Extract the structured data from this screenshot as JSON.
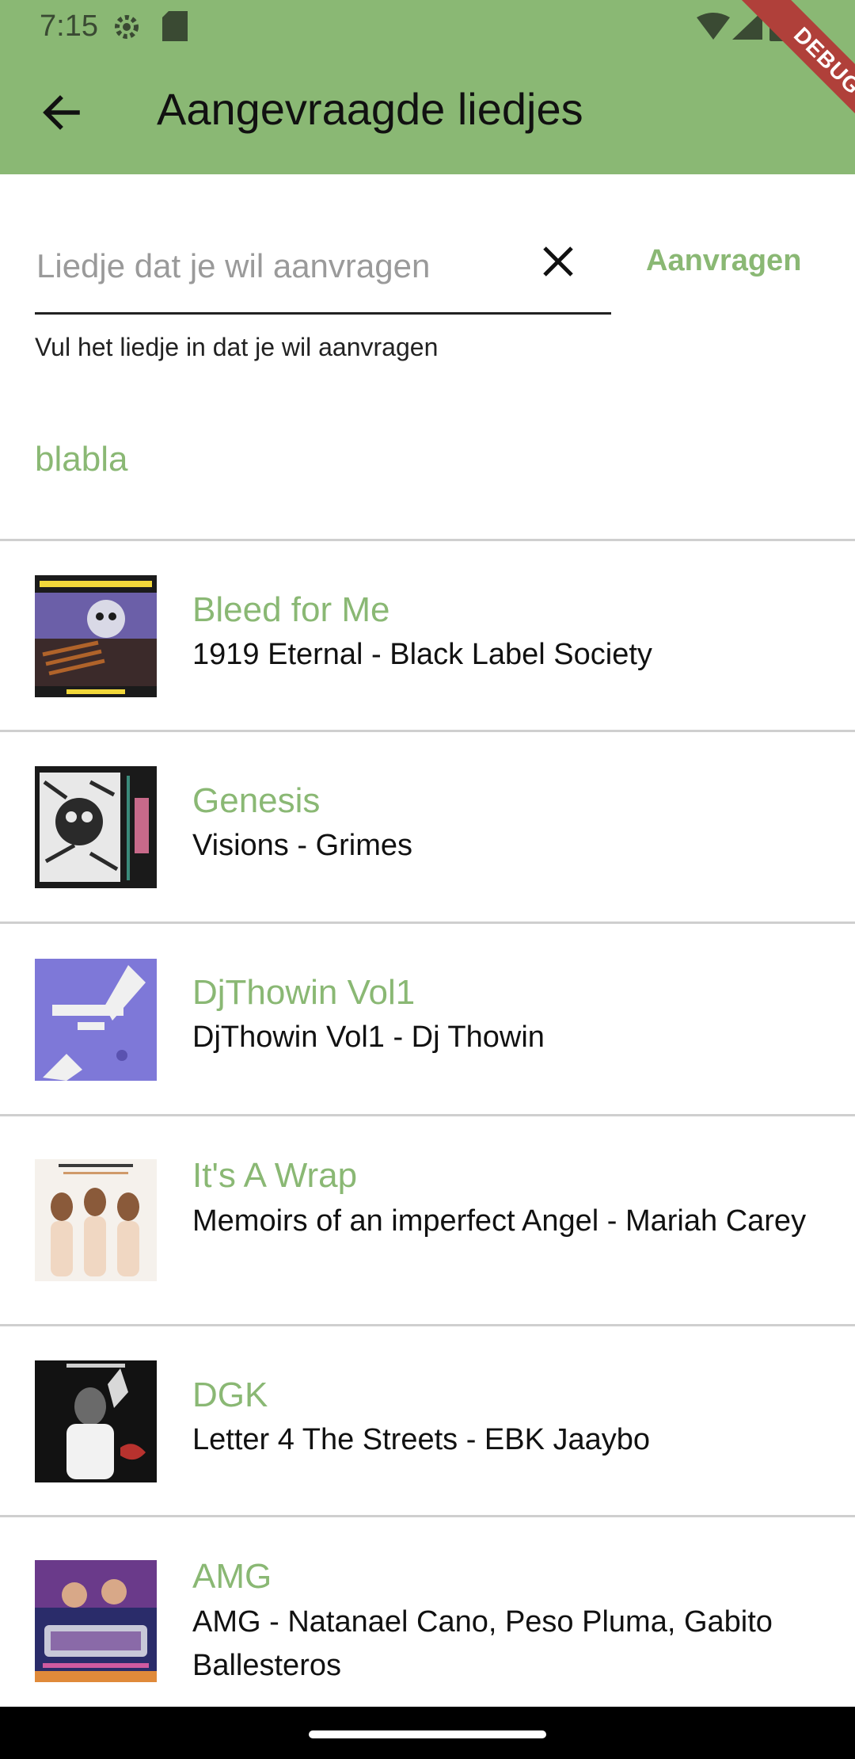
{
  "status_bar": {
    "time": "7:15",
    "icons": [
      "gear-icon",
      "sd-card-icon",
      "wifi-icon",
      "signal-icon",
      "battery-icon"
    ]
  },
  "debug_banner": "DEBUG",
  "app_bar": {
    "title": "Aangevraagde liedjes",
    "back_icon": "arrow-back-icon"
  },
  "request_form": {
    "input_value": "",
    "input_placeholder": "Liedje dat je wil aanvragen",
    "clear_icon": "close-icon",
    "submit_label": "Aanvragen",
    "helper_text": "Vul het liedje in dat je wil aanvragen"
  },
  "entered_request": "blabla",
  "songs": [
    {
      "title": "Bleed for Me",
      "subtitle": "1919 Eternal - Black Label Society"
    },
    {
      "title": "Genesis",
      "subtitle": "Visions - Grimes"
    },
    {
      "title": "DjThowin Vol1",
      "subtitle": "DjThowin Vol1 - Dj Thowin"
    },
    {
      "title": "It's A Wrap",
      "subtitle": "Memoirs of an imperfect Angel - Mariah Carey"
    },
    {
      "title": "DGK",
      "subtitle": "Letter 4 The Streets - EBK Jaaybo"
    },
    {
      "title": "AMG",
      "subtitle": "AMG - Natanael Cano, Peso Pluma, Gabito Ballesteros"
    }
  ],
  "colors": {
    "accent": "#8ab874",
    "text": "#111111",
    "divider": "#cfcfcf"
  }
}
